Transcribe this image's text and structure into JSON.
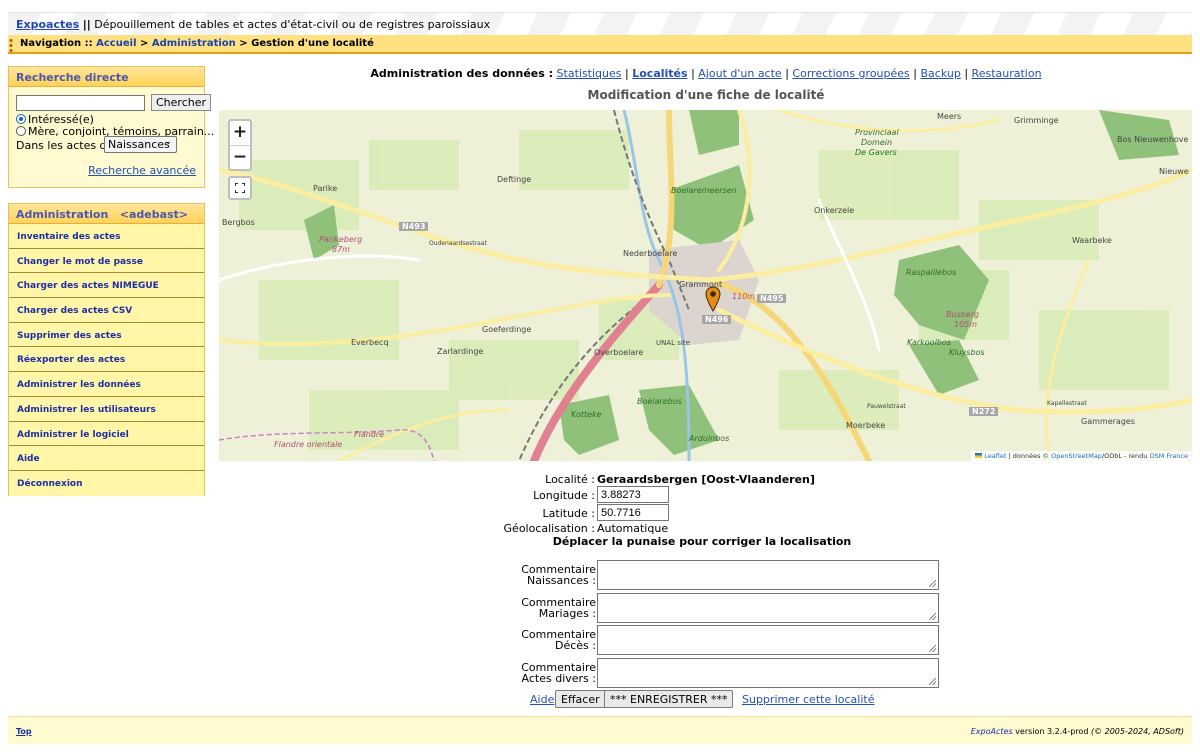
{
  "header": {
    "brand": "Expoactes",
    "separator": "||",
    "subtitle": "Dépouillement de tables et actes d'état-civil ou de registres paroissiaux"
  },
  "navbar": {
    "label": "Navigation ::",
    "home": "Accueil",
    "arrow1": ">",
    "admin": "Administration",
    "arrow2": ">",
    "current": "Gestion d'une localité"
  },
  "search": {
    "title": "Recherche directe",
    "input_value": "",
    "button": "Chercher",
    "opt_interested": "Intéressé(e)",
    "opt_others": "Mère, conjoint, témoins, parrain...",
    "in_acts_label": "Dans les actes de",
    "acts_selected": "Naissances",
    "advanced": "Recherche avancée"
  },
  "admin_panel": {
    "title": "Administration",
    "user": "<adebast>",
    "items": [
      "Inventaire des actes",
      "Changer le mot de passe",
      "Charger des actes NIMEGUE",
      "Charger des actes CSV",
      "Supprimer des actes",
      "Réexporter des actes",
      "Administrer les données",
      "Administrer les utilisateurs",
      "Administrer le logiciel",
      "Aide",
      "Déconnexion"
    ]
  },
  "admin_links": {
    "label": "Administration des données :",
    "links": [
      "Statistiques",
      "Localités",
      "Ajout d'un acte",
      "Corrections groupées",
      "Backup",
      "Restauration"
    ],
    "sep": "|"
  },
  "page_title": "Modification d'une fiche de localité",
  "map": {
    "zoom_in": "+",
    "zoom_out": "−",
    "attribution_leaflet": "Leaflet",
    "attribution_text": "| données ©",
    "attribution_osm": "OpenStreetMap",
    "attribution_text2": "/ODbL - rendu",
    "attribution_osmfr": "OSM France",
    "labels": {
      "meers": "Meers",
      "grimminge": "Grimminge",
      "provinciaal1": "Provinciaal",
      "provinciaal2": "Domein",
      "provinciaal3": "De Gavers",
      "bos": "Bos Nieuwenhove",
      "nieuwe": "Nieuwe",
      "parike": "Parike",
      "deftinge": "Deftinge",
      "boelare": "Boelaremeersen",
      "onkerzele": "Onkerzele",
      "parikeberg": "Parikeberg",
      "parikeberg_alt": "87m",
      "bergbos": "Bergbos",
      "waarbeke": "Waarbeke",
      "nederboelare": "Nederboelare",
      "grammont": "Grammont",
      "elev110": "110m",
      "raspaille": "Raspaillebos",
      "goeferdinge": "Goeferdinge",
      "everbecq": "Everbecq",
      "zarlardinge": "Zarlardinge",
      "overboelare": "Overboelare",
      "unal": "UNAL site",
      "busberg": "Busberg",
      "busberg_alt": "105m",
      "karkoolbos": "Karkoolbos",
      "kluysbos": "Kluysbos",
      "boelarebos": "Boelarebos",
      "kotteke": "Kotteke",
      "moerbeke": "Moerbeke",
      "gammerages": "Gammerages",
      "flandre": "Flandre orientale",
      "flandre2": "Flandre",
      "oudenaard": "Oudenaardsestraat",
      "pauwel": "Pauwelstraat",
      "kapelle": "Kapellestraat",
      "ardenbos": "Arduinbos",
      "n493": "N493",
      "n495": "N495",
      "n496": "N496",
      "n272": "N272"
    }
  },
  "details": {
    "localite_label": "Localité :",
    "localite_value": "Geraardsbergen [Oost-Vlaanderen]",
    "longitude_label": "Longitude :",
    "longitude_value": "3.88273",
    "latitude_label": "Latitude :",
    "latitude_value": "50.7716",
    "geoloc_label": "Géolocalisation :",
    "geoloc_value": "Automatique",
    "pin_hint": "Déplacer la punaise pour corriger la localisation"
  },
  "comments": [
    {
      "line1": "Commentaire",
      "line2": "Naissances :"
    },
    {
      "line1": "Commentaire",
      "line2": "Mariages :"
    },
    {
      "line1": "Commentaire",
      "line2": "Décès :"
    },
    {
      "line1": "Commentaire",
      "line2": "Actes divers :"
    }
  ],
  "actions": {
    "help": "Aide",
    "clear": "Effacer",
    "save": "*** ENREGISTRER ***",
    "delete": "Supprimer cette localité"
  },
  "footer": {
    "top": "Top",
    "app": "ExpoActes",
    "version": "version 3.2.4-prod",
    "copyright": "(© 2005-2024, ADSoft)"
  }
}
